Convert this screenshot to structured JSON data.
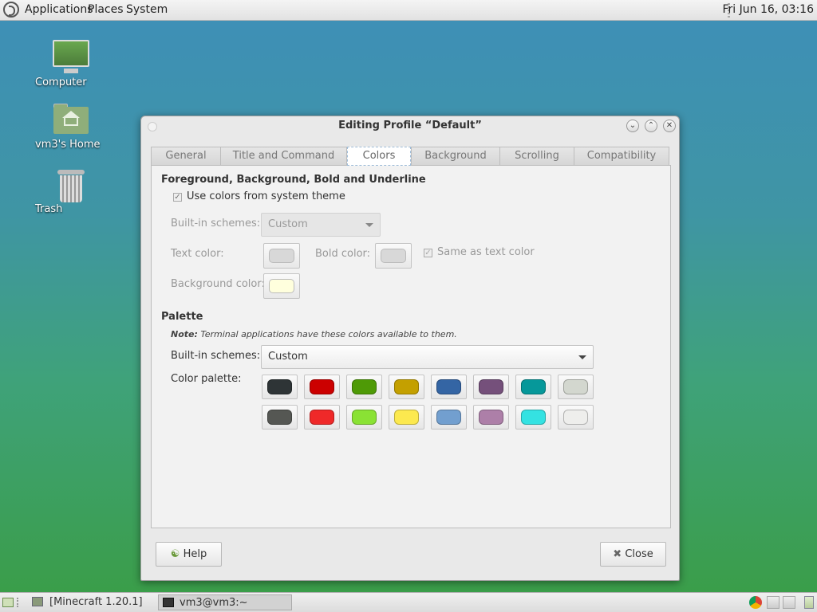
{
  "top_panel": {
    "menus": [
      "Applications",
      "Places",
      "System"
    ],
    "clock": "Fri Jun 16, 03:16"
  },
  "desktop_icons": [
    {
      "label": "Computer"
    },
    {
      "label": "vm3's Home"
    },
    {
      "label": "Trash"
    }
  ],
  "dialog": {
    "title": "Editing Profile “Default”",
    "tabs": [
      "General",
      "Title and Command",
      "Colors",
      "Background",
      "Scrolling",
      "Compatibility"
    ],
    "active_tab": "Colors",
    "fg_section": {
      "title": "Foreground, Background, Bold and Underline",
      "use_system_colors_label": "Use colors from system theme",
      "use_system_colors_checked": true,
      "builtin_label": "Built-in schemes:",
      "builtin_value": "Custom",
      "text_color_label": "Text color:",
      "bold_color_label": "Bold color:",
      "same_as_text_label": "Same as text color",
      "same_as_text_checked": true,
      "background_color_label": "Background color:",
      "text_color": "#d8d8d8",
      "bold_color": "#d8d8d8",
      "background_color": "#ffffdd"
    },
    "palette_section": {
      "title": "Palette",
      "note_bold": "Note:",
      "note_text": " Terminal applications have these colors available to them.",
      "builtin_label": "Built-in schemes:",
      "builtin_value": "Custom",
      "palette_label": "Color palette:",
      "colors_row1": [
        "#2e3436",
        "#cc0000",
        "#4e9a06",
        "#c4a000",
        "#3465a4",
        "#75507b",
        "#06989a",
        "#d3d7cf"
      ],
      "colors_row2": [
        "#555753",
        "#ef2929",
        "#8ae234",
        "#fce94f",
        "#729fcf",
        "#ad7fa8",
        "#34e2e2",
        "#eeeeec"
      ]
    },
    "help_label": "Help",
    "close_label": "Close"
  },
  "taskbar": {
    "items": [
      {
        "label": "[Minecraft 1.20.1]",
        "active": false
      },
      {
        "label": "vm3@vm3:~",
        "active": true
      }
    ]
  }
}
